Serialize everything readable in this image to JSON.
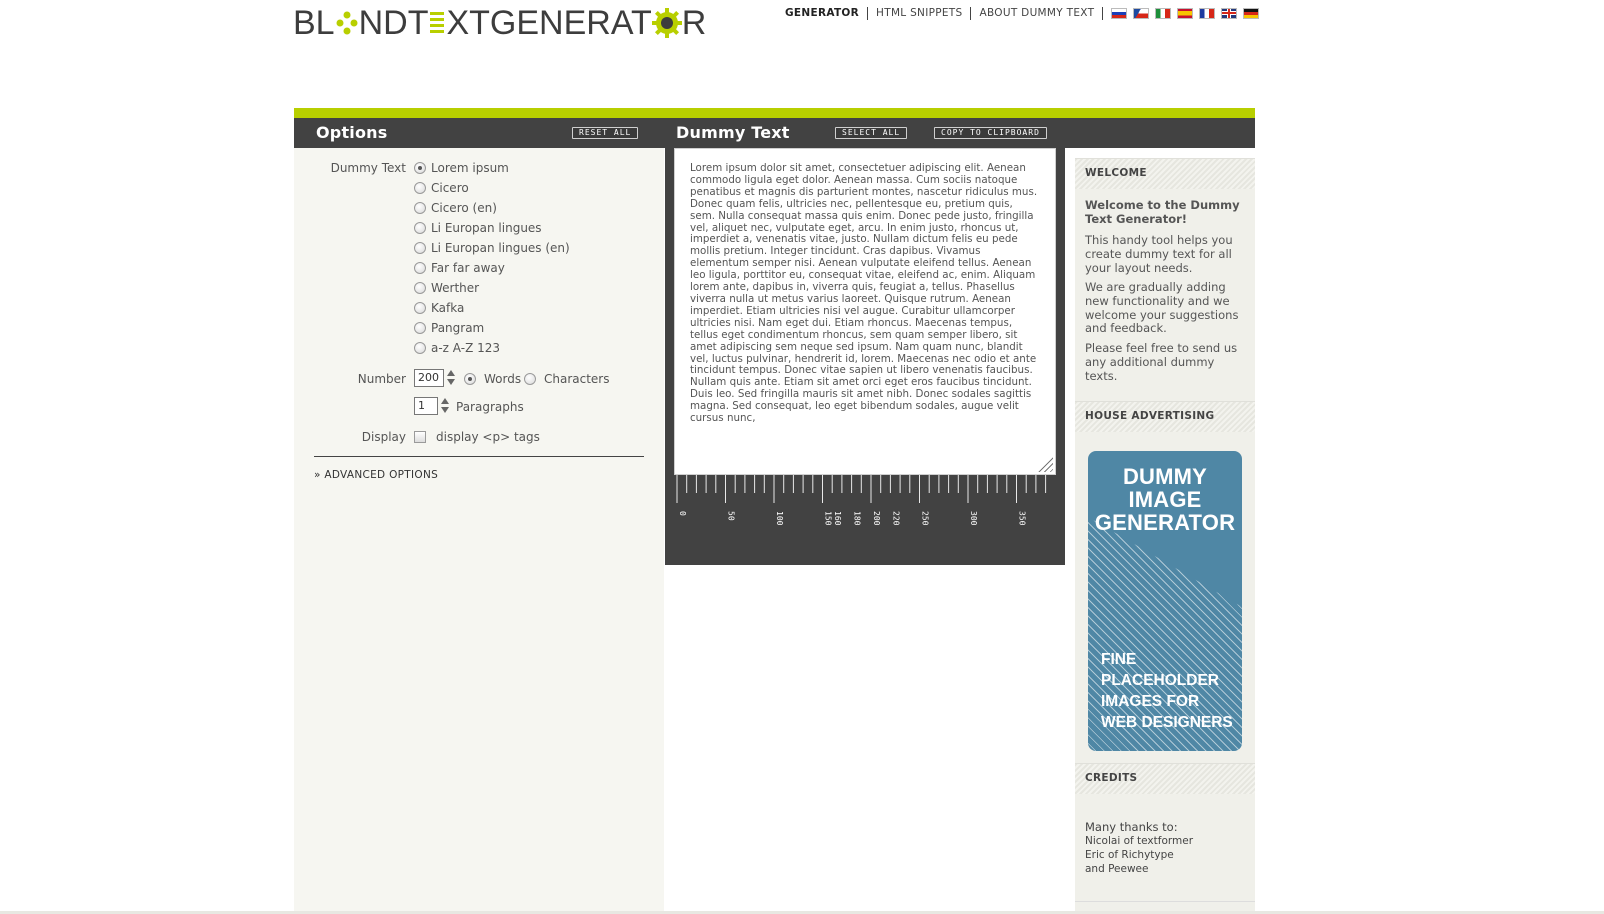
{
  "brand": {
    "logo_part1": "BL",
    "logo_part2": "NDT",
    "logo_part3": "XTGENERAT",
    "logo_part4": "R",
    "accent_color": "#b8cf00",
    "dark_color": "#424242"
  },
  "topnav": {
    "items": [
      "GENERATOR",
      "HTML SNIPPETS",
      "ABOUT DUMMY TEXT"
    ],
    "flags": [
      "flag-ru-icon",
      "flag-cz-icon",
      "flag-it-icon",
      "flag-es-icon",
      "flag-fr-icon",
      "flag-gb-icon",
      "flag-de-icon"
    ]
  },
  "options": {
    "title": "Options",
    "reset_label": "RESET ALL",
    "dummy_text_label": "Dummy Text",
    "dummy_text_choices": [
      "Lorem ipsum",
      "Cicero",
      "Cicero (en)",
      "Li Europan lingues",
      "Li Europan lingues (en)",
      "Far far away",
      "Werther",
      "Kafka",
      "Pangram",
      "a-z A-Z 123"
    ],
    "selected_choice": "Lorem ipsum",
    "number_label": "Number",
    "number_value": "200",
    "unit_words": "Words",
    "unit_characters": "Characters",
    "selected_unit": "Words",
    "paragraphs_value": "1",
    "paragraphs_label": "Paragraphs",
    "display_label": "Display",
    "display_option": "display <p> tags",
    "advanced_label": "» ADVANCED OPTIONS"
  },
  "dummy_text": {
    "title": "Dummy Text",
    "select_all_label": "SELECT ALL",
    "copy_label": "COPY TO CLIPBOARD",
    "body": "Lorem ipsum dolor sit amet, consectetuer adipiscing elit. Aenean commodo ligula eget dolor. Aenean massa. Cum sociis natoque penatibus et magnis dis parturient montes, nascetur ridiculus mus. Donec quam felis, ultricies nec, pellentesque eu, pretium quis, sem. Nulla consequat massa quis enim. Donec pede justo, fringilla vel, aliquet nec, vulputate eget, arcu. In enim justo, rhoncus ut, imperdiet a, venenatis vitae, justo. Nullam dictum felis eu pede mollis pretium. Integer tincidunt. Cras dapibus. Vivamus elementum semper nisi. Aenean vulputate eleifend tellus. Aenean leo ligula, porttitor eu, consequat vitae, eleifend ac, enim. Aliquam lorem ante, dapibus in, viverra quis, feugiat a, tellus. Phasellus viverra nulla ut metus varius laoreet. Quisque rutrum. Aenean imperdiet. Etiam ultricies nisi vel augue. Curabitur ullamcorper ultricies nisi. Nam eget dui. Etiam rhoncus. Maecenas tempus, tellus eget condimentum rhoncus, sem quam semper libero, sit amet adipiscing sem neque sed ipsum. Nam quam nunc, blandit vel, luctus pulvinar, hendrerit id, lorem. Maecenas nec odio et ante tincidunt tempus. Donec vitae sapien ut libero venenatis faucibus. Nullam quis ante. Etiam sit amet orci eget eros faucibus tincidunt. Duis leo. Sed fringilla mauris sit amet nibh. Donec sodales sagittis magna. Sed consequat, leo eget bibendum sodales, augue velit cursus nunc,",
    "ruler_labels": [
      "0",
      "50",
      "100",
      "150",
      "160",
      "180",
      "200",
      "220",
      "250",
      "300",
      "350"
    ]
  },
  "sidebar": {
    "welcome_head": "WELCOME",
    "welcome_title": "Welcome to the Dummy Text Generator!",
    "welcome_p1": "This handy tool helps you create dummy text for all your layout needs.",
    "welcome_p2": "We are gradually adding new functionality and we welcome your suggestions and feedback.",
    "welcome_p3": "Please feel free to send us any additional dummy texts.",
    "house_head": "HOUSE ADVERTISING",
    "ad_title_1": "DUMMY",
    "ad_title_2": "IMAGE",
    "ad_title_3": "GENERATOR",
    "ad_sub_1": "FINE",
    "ad_sub_2": "PLACEHOLDER",
    "ad_sub_3": "IMAGES FOR",
    "ad_sub_4": "WEB DESIGNERS",
    "credits_head": "CREDITS",
    "credits_1": "Many thanks to:",
    "credits_2": "Nicolai of textformer",
    "credits_3": "Eric of Richytype",
    "credits_4": "and Peewee"
  }
}
